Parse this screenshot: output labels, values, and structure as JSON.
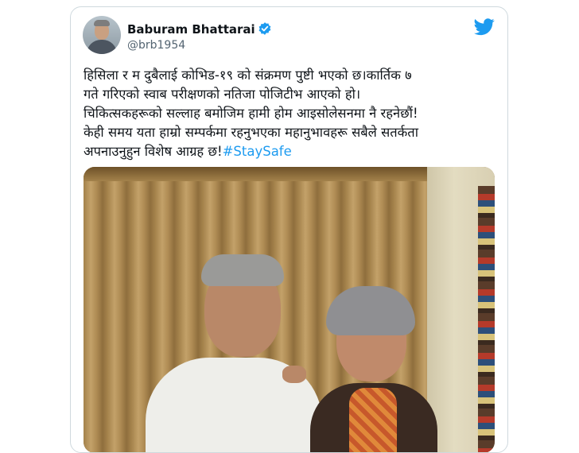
{
  "tweet": {
    "display_name": "Baburam Bhattarai",
    "handle": "@brb1954",
    "lines": [
      "हिसिला र म दुबैलाई कोभिड-१९ को संक्रमण पुष्टी भएको छ।कार्तिक ७",
      "गते गरिएको स्वाब परीक्षणको नतिजा पोजिटीभ आएको हो।",
      "चिकित्सकहरूको सल्लाह बमोजिम हामी होम आइसोलेसनमा नै रहनेछौं!",
      "केही समय यता हाम्रो सम्पर्कमा रहनुभएका महानुभावहरू सबैले सतर्कता"
    ],
    "last_line_text": "अपनाउनुहुन विशेष आग्रह छ!",
    "hashtag": "#StaySafe"
  },
  "colors": {
    "accent": "#1d9bf0",
    "text": "#0f1419",
    "muted": "#536471",
    "border": "#cfd9de"
  },
  "icons": {
    "verified": "verified-badge-icon",
    "brand": "twitter-bird-icon"
  }
}
